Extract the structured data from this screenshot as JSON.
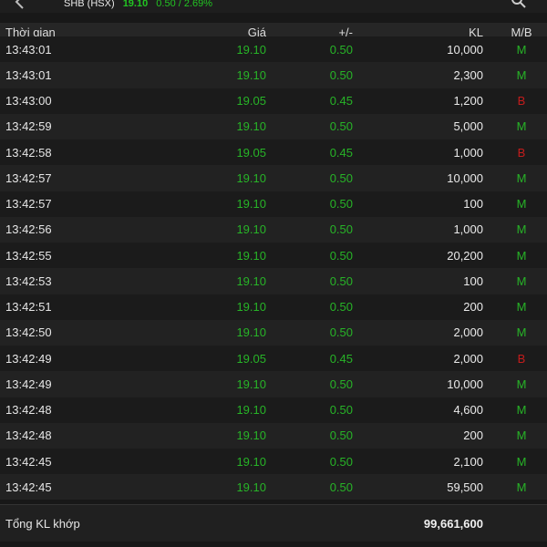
{
  "topbar": {
    "symbol": "SHB (HSX)",
    "price": "19.10",
    "change": "0.50 / 2.69%"
  },
  "table": {
    "headers": {
      "time": "Thời gian",
      "price": "Giá",
      "change": "+/-",
      "volume": "KL",
      "side": "M/B"
    },
    "rows": [
      {
        "time": "13:43:01",
        "price": "19.10",
        "change": "0.50",
        "volume": "10,000",
        "side": "M"
      },
      {
        "time": "13:43:01",
        "price": "19.10",
        "change": "0.50",
        "volume": "2,300",
        "side": "M"
      },
      {
        "time": "13:43:00",
        "price": "19.05",
        "change": "0.45",
        "volume": "1,200",
        "side": "B"
      },
      {
        "time": "13:42:59",
        "price": "19.10",
        "change": "0.50",
        "volume": "5,000",
        "side": "M"
      },
      {
        "time": "13:42:58",
        "price": "19.05",
        "change": "0.45",
        "volume": "1,000",
        "side": "B"
      },
      {
        "time": "13:42:57",
        "price": "19.10",
        "change": "0.50",
        "volume": "10,000",
        "side": "M"
      },
      {
        "time": "13:42:57",
        "price": "19.10",
        "change": "0.50",
        "volume": "100",
        "side": "M"
      },
      {
        "time": "13:42:56",
        "price": "19.10",
        "change": "0.50",
        "volume": "1,000",
        "side": "M"
      },
      {
        "time": "13:42:55",
        "price": "19.10",
        "change": "0.50",
        "volume": "20,200",
        "side": "M"
      },
      {
        "time": "13:42:53",
        "price": "19.10",
        "change": "0.50",
        "volume": "100",
        "side": "M"
      },
      {
        "time": "13:42:51",
        "price": "19.10",
        "change": "0.50",
        "volume": "200",
        "side": "M"
      },
      {
        "time": "13:42:50",
        "price": "19.10",
        "change": "0.50",
        "volume": "2,000",
        "side": "M"
      },
      {
        "time": "13:42:49",
        "price": "19.05",
        "change": "0.45",
        "volume": "2,000",
        "side": "B"
      },
      {
        "time": "13:42:49",
        "price": "19.10",
        "change": "0.50",
        "volume": "10,000",
        "side": "M"
      },
      {
        "time": "13:42:48",
        "price": "19.10",
        "change": "0.50",
        "volume": "4,600",
        "side": "M"
      },
      {
        "time": "13:42:48",
        "price": "19.10",
        "change": "0.50",
        "volume": "200",
        "side": "M"
      },
      {
        "time": "13:42:45",
        "price": "19.10",
        "change": "0.50",
        "volume": "2,100",
        "side": "M"
      },
      {
        "time": "13:42:45",
        "price": "19.10",
        "change": "0.50",
        "volume": "59,500",
        "side": "M"
      }
    ]
  },
  "footer": {
    "label": "Tổng KL khớp",
    "total": "99,661,600"
  },
  "colors": {
    "background": "#181818",
    "up_green": "#27b427",
    "sell_red": "#c41c1c",
    "text": "#e6e6e6"
  }
}
